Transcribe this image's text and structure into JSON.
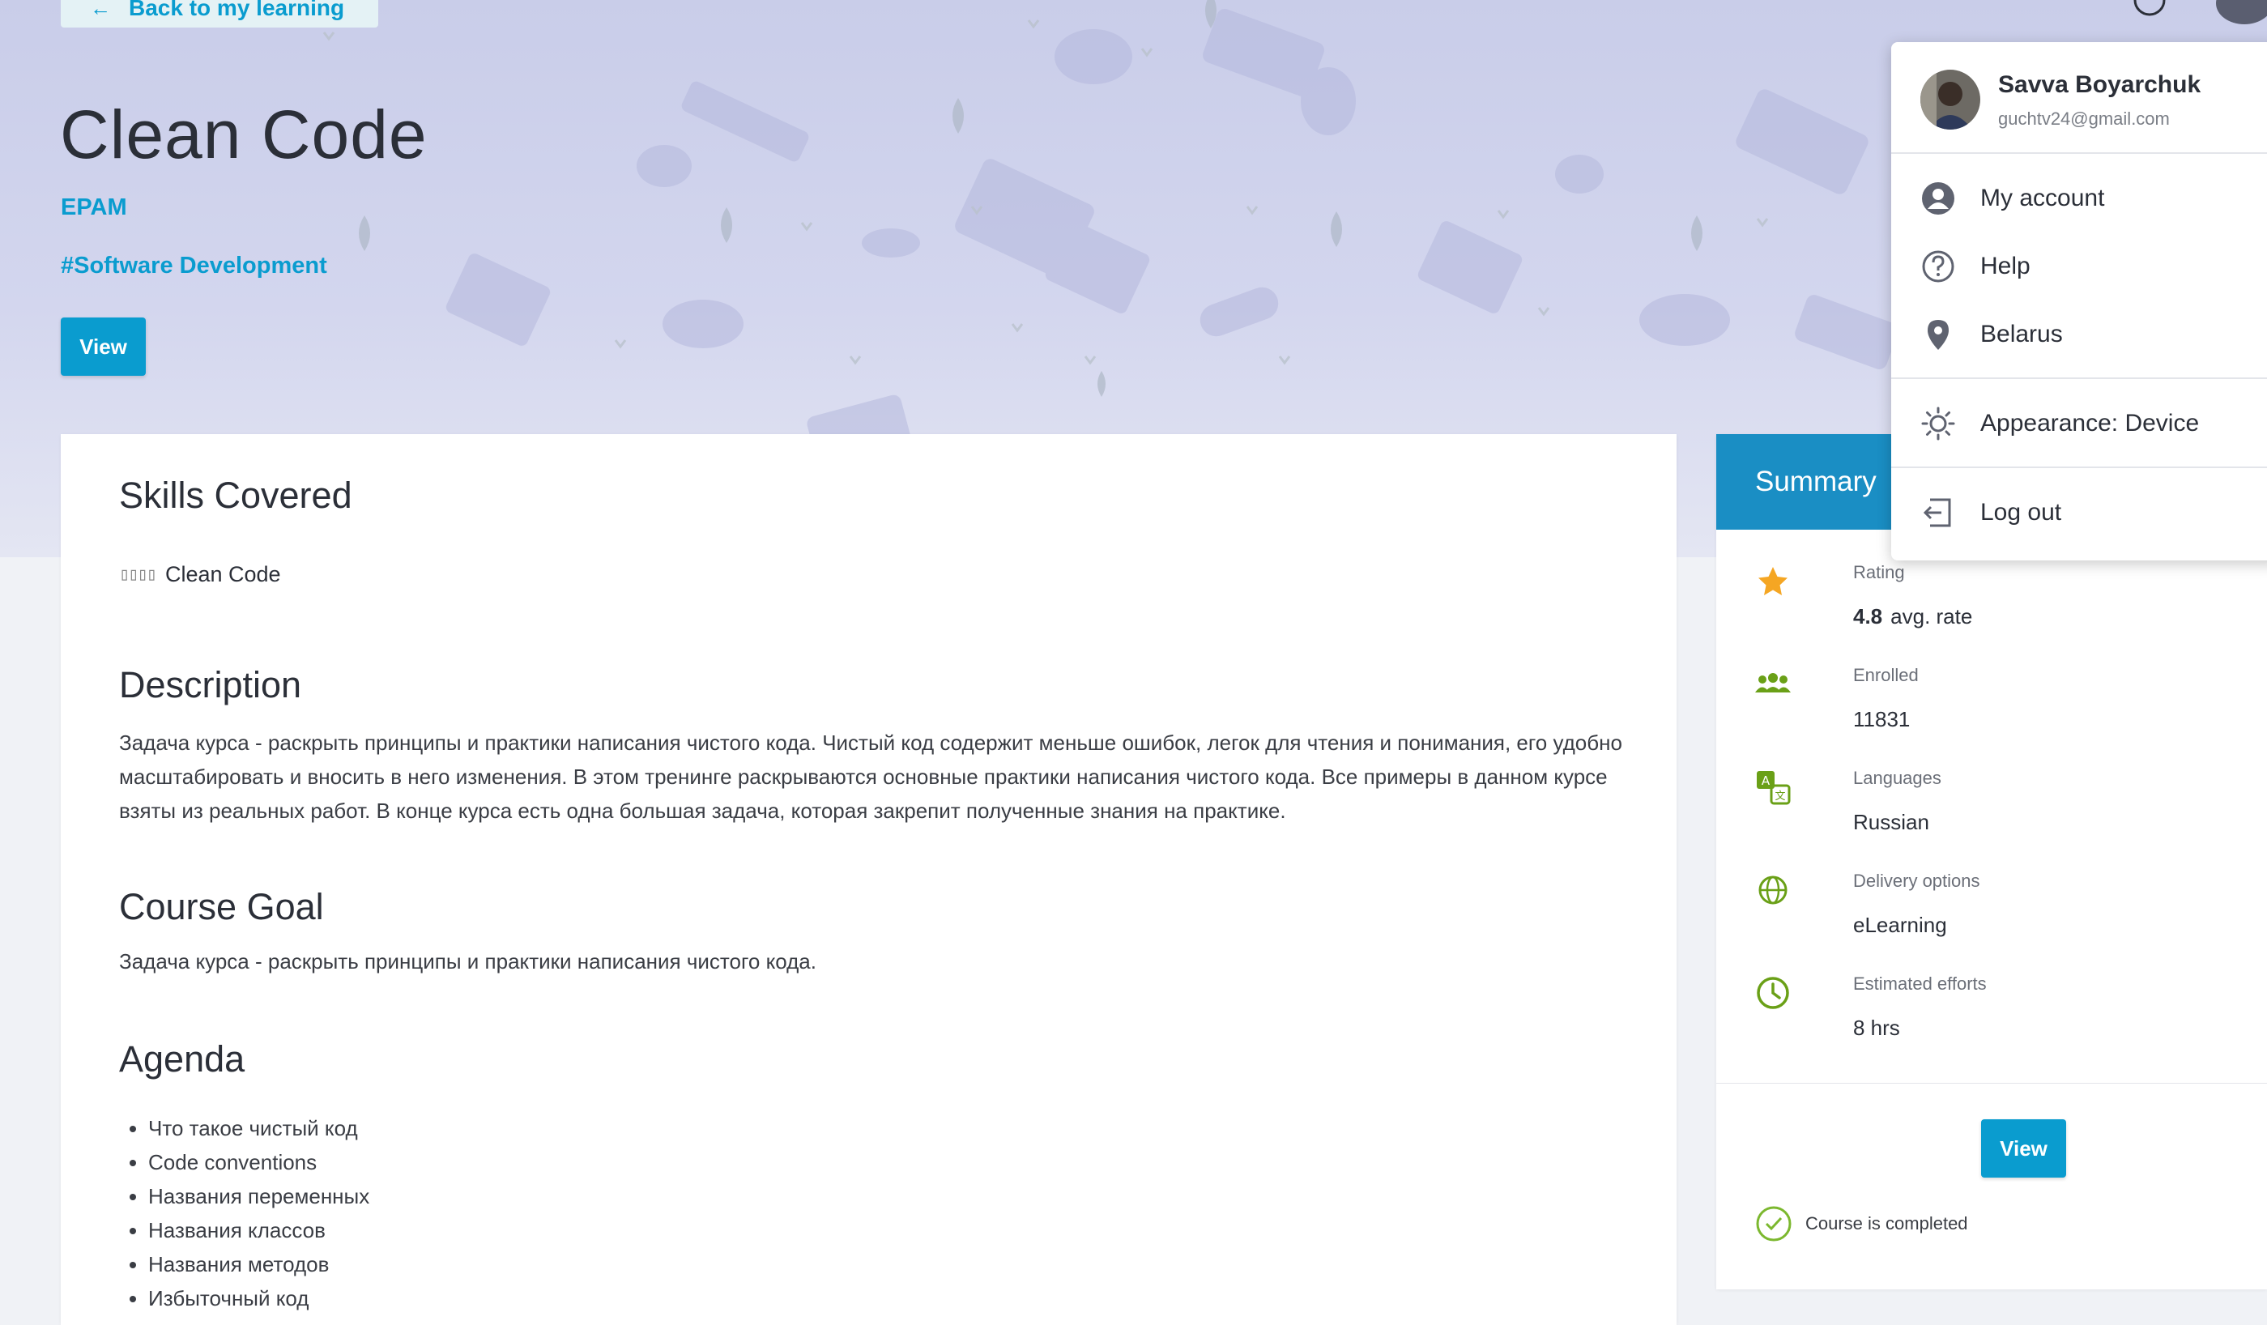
{
  "hero": {
    "back_label": "Back to my learning",
    "title": "Clean Code",
    "provider": "EPAM",
    "tag": "#Software Development",
    "view_label": "View"
  },
  "content": {
    "skills_heading": "Skills Covered",
    "skill_placeholder": "▯▯▯▯",
    "skill": "Clean Code",
    "description_heading": "Description",
    "description": " Задача курса - раскрыть принципы и практики написания чистого кода. Чистый код содержит меньше ошибок, легок для чтения и понимания, его удобно масштабировать и вносить в него изменения. В этом тренинге раскрываются основные практики написания чистого кода. Все примеры в данном курсе взяты из реальных работ. В конце курса есть одна большая задача, которая закрепит полученные знания на практике.",
    "goal_heading": "Course Goal",
    "goal": "Задача курса - раскрыть принципы и практики написания чистого кода.",
    "agenda_heading": "Agenda",
    "agenda": [
      "Что такое чистый код",
      "Code conventions",
      "Названия переменных",
      "Названия классов",
      "Названия методов",
      "Избыточный код"
    ]
  },
  "summary": {
    "heading": "Summary",
    "rating_label": "Rating",
    "rating_value": "4.8",
    "rating_suffix": "avg. rate",
    "enrolled_label": "Enrolled",
    "enrolled_value": "11831",
    "languages_label": "Languages",
    "languages_value": "Russian",
    "delivery_label": "Delivery options",
    "delivery_value": "eLearning",
    "efforts_label": "Estimated efforts",
    "efforts_value": "8 hrs",
    "view_label": "View",
    "completed_text": "Course is completed"
  },
  "user_menu": {
    "name": "Savva Boyarchuk",
    "email": "guchtv24@gmail.com",
    "items": {
      "account": "My account",
      "help": "Help",
      "region": "Belarus",
      "appearance": "Appearance: Device",
      "logout": "Log out"
    }
  },
  "colors": {
    "accent": "#0a9ccf",
    "summary_header": "#1a8ec4",
    "icon_green": "#6aa017",
    "star": "#f5a623"
  },
  "icons": [
    "arrow-left-icon",
    "help-icon",
    "star-icon",
    "people-icon",
    "translate-icon",
    "globe-icon",
    "clock-icon",
    "check-circle-icon",
    "account-icon",
    "location-icon",
    "sun-icon",
    "logout-icon"
  ]
}
